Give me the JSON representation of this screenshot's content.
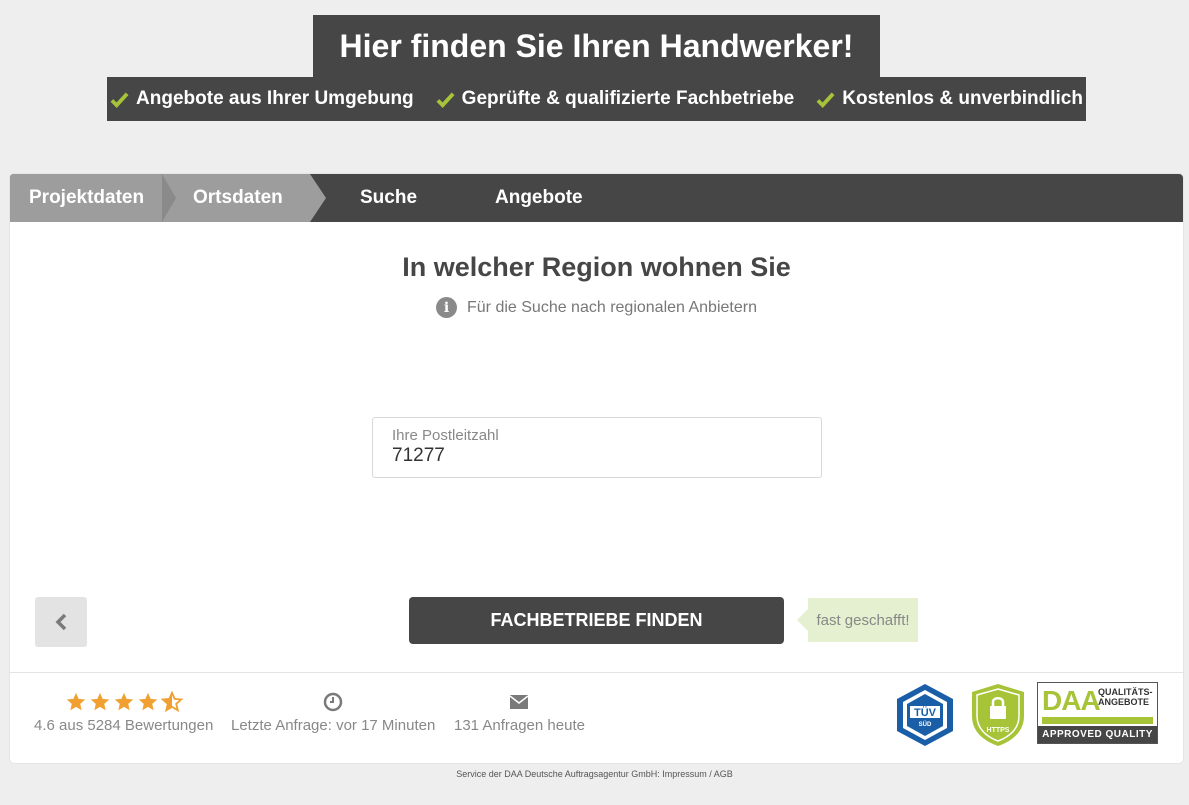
{
  "header": {
    "title": "Hier finden Sie Ihren Handwerker!",
    "usps": [
      "Angebote aus Ihrer Umgebung",
      "Geprüfte & qualifizierte Fachbetriebe",
      "Kostenlos & unverbindlich"
    ],
    "accent_color": "#a7c439"
  },
  "steps": [
    "Projektdaten",
    "Ortsdaten",
    "Suche",
    "Angebote"
  ],
  "question": {
    "title": "In welcher Region wohnen Sie",
    "hint": "Für die Suche nach regionalen Anbietern"
  },
  "postcode_field": {
    "label": "Ihre Postleitzahl",
    "value": "71277"
  },
  "actions": {
    "back_icon": "chevron-left-icon",
    "submit_label": "FACHBETRIEBE FINDEN",
    "progress_note": "fast geschafft!"
  },
  "stats": {
    "rating_text": "4.6 aus 5284 Bewertungen",
    "rating_value": 4.6,
    "last_request": "Letzte Anfrage: vor 17 Minuten",
    "requests_today": "131 Anfragen heute"
  },
  "badges": {
    "tuv": "TÜV",
    "tuv_sub": "SÜD",
    "https": "HTTPS",
    "daa_logo": "DAA",
    "daa_quality_1": "QUALITÄTS-",
    "daa_quality_2": "ANGEBOTE",
    "daa_approved": "APPROVED QUALITY"
  },
  "footer": {
    "service_text": "Service der DAA Deutsche Auftragsagentur GmbH: Impressum / AGB"
  }
}
